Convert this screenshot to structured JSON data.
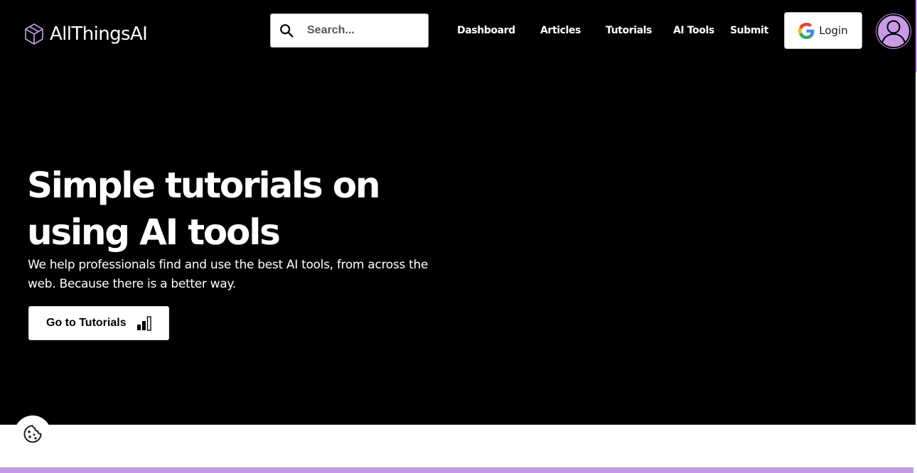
{
  "brand": {
    "name": "AllThingsAI"
  },
  "search": {
    "placeholder": "Search..."
  },
  "nav": {
    "items": [
      {
        "label": "Dashboard"
      },
      {
        "label": "Articles"
      },
      {
        "label": "Tutorials"
      },
      {
        "label": "AI Tools"
      },
      {
        "label": "Submit"
      }
    ]
  },
  "login": {
    "label": "Login"
  },
  "hero": {
    "title": "Simple tutorials on using AI tools",
    "subtitle": "We help professionals find and use the best AI tools, from across the web. Because there is a better way.",
    "cta_label": "Go to Tutorials"
  },
  "icons": {
    "logo": "hexagon-cube-icon",
    "search": "search-icon",
    "google": "google-icon",
    "avatar": "user-icon",
    "cta": "bar-chart-icon",
    "cookie": "cookie-icon"
  },
  "colors": {
    "background": "#000000",
    "accent": "#c79ae6",
    "text": "#ffffff",
    "button_bg": "#ffffff",
    "google_blue": "#4285F4",
    "google_red": "#EA4335",
    "google_yellow": "#FBBC05",
    "google_green": "#34A853"
  }
}
